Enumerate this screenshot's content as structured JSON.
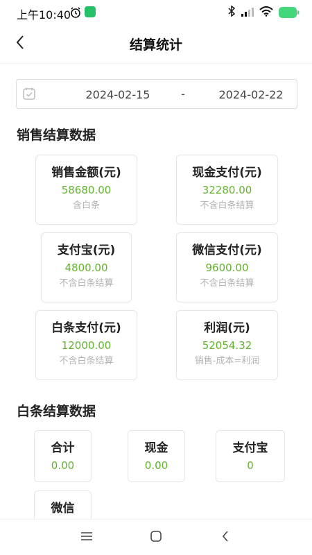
{
  "status_bar": {
    "time": "上午10:40",
    "icons": [
      "alarm-icon",
      "app-notification-icon",
      "bluetooth-icon",
      "signal-icon",
      "wifi-icon",
      "battery-icon"
    ]
  },
  "header": {
    "title": "结算统计",
    "back_icon": "chevron-left-icon"
  },
  "date_range": {
    "icon": "calendar-icon",
    "start": "2024-02-15",
    "separator": "-",
    "end": "2024-02-22"
  },
  "sales_section": {
    "title": "销售结算数据",
    "cards": [
      {
        "label": "销售金额(元)",
        "value": "58680.00",
        "note": "含白条"
      },
      {
        "label": "现金支付(元)",
        "value": "32280.00",
        "note": "不含白条结算"
      },
      {
        "label": "支付宝(元)",
        "value": "4800.00",
        "note": "不含白条结算"
      },
      {
        "label": "微信支付(元)",
        "value": "9600.00",
        "note": "不含白条结算"
      },
      {
        "label": "白条支付(元)",
        "value": "12000.00",
        "note": "不含白条结算"
      },
      {
        "label": "利润(元)",
        "value": "52054.32",
        "note": "销售-成本=利润"
      }
    ]
  },
  "baitiao_section": {
    "title": "白条结算数据",
    "cards": [
      {
        "label": "合计",
        "value": "0.00"
      },
      {
        "label": "现金",
        "value": "0.00"
      },
      {
        "label": "支付宝",
        "value": "0"
      },
      {
        "label": "微信",
        "value": ""
      }
    ]
  },
  "nav_bar": {
    "items": [
      "menu-icon",
      "home-icon",
      "back-icon"
    ]
  },
  "colors": {
    "value_green": "#62b42c",
    "note_gray": "#b3b3b3",
    "battery_green": "#43d67a"
  }
}
